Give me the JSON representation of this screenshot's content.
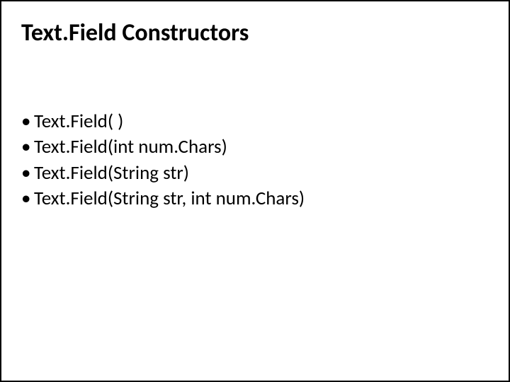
{
  "title": "Text.Field Constructors",
  "bullets": [
    "Text.Field( )",
    "Text.Field(int num.Chars)",
    "Text.Field(String str)",
    "Text.Field(String str, int num.Chars)"
  ],
  "bullet_glyph": "•"
}
